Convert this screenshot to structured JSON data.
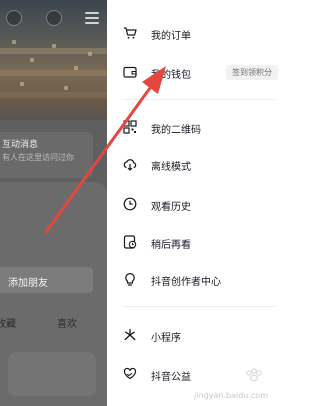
{
  "profile": {
    "notice_title": "互动消息",
    "notice_subtitle": "有人在这里访问过你",
    "add_friend": "添加朋友",
    "tab_left": "收藏",
    "tab_right": "喜欢"
  },
  "drawer": {
    "items": [
      {
        "label": "我的订单",
        "icon": "cart-icon"
      },
      {
        "label": "我的钱包",
        "icon": "wallet-icon",
        "badge": "签到领积分"
      },
      {
        "label": "我的二维码",
        "icon": "qrcode-icon"
      },
      {
        "label": "离线模式",
        "icon": "cloud-download-icon"
      },
      {
        "label": "观看历史",
        "icon": "clock-icon"
      },
      {
        "label": "稍后再看",
        "icon": "watch-later-icon"
      },
      {
        "label": "抖音创作者中心",
        "icon": "bulb-icon"
      },
      {
        "label": "小程序",
        "icon": "mini-program-icon"
      },
      {
        "label": "抖音公益",
        "icon": "heart-hands-icon"
      }
    ]
  },
  "watermark": "jingyan.baidu.com",
  "colors": {
    "annotation_arrow": "#e4473f",
    "text": "#161823",
    "dim_overlay": "#5f5f5f"
  }
}
